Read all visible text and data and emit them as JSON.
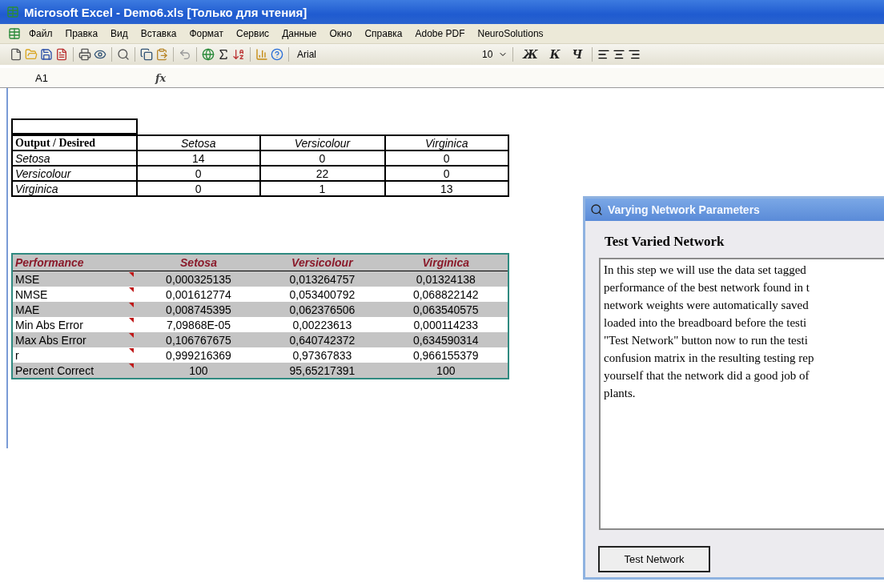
{
  "window": {
    "title": "Microsoft Excel - Demo6.xls  [Только для чтения]"
  },
  "menu": [
    "Файл",
    "Правка",
    "Вид",
    "Вставка",
    "Формат",
    "Сервис",
    "Данные",
    "Окно",
    "Справка",
    "Adobe PDF",
    "NeuroSolutions"
  ],
  "toolbar": {
    "font": "Arial",
    "size": "10",
    "format_buttons": [
      "Ж",
      "К",
      "Ч"
    ]
  },
  "formula_bar": {
    "name_box": "A1",
    "fx": "fx"
  },
  "confusion_table": {
    "columns": [
      "Output / Desired",
      "Setosa",
      "Versicolour",
      "Virginica"
    ],
    "rows": [
      [
        "Setosa",
        "14",
        "0",
        "0"
      ],
      [
        "Versicolour",
        "0",
        "22",
        "0"
      ],
      [
        "Virginica",
        "0",
        "1",
        "13"
      ]
    ]
  },
  "performance_table": {
    "columns": [
      "Performance",
      "Setosa",
      "Versicolour",
      "Virginica"
    ],
    "rows": [
      {
        "cells": [
          "MSE",
          "0,000325135",
          "0,013264757",
          "0,01324138"
        ],
        "comment": true
      },
      {
        "cells": [
          "NMSE",
          "0,001612774",
          "0,053400792",
          "0,068822142"
        ],
        "comment": true
      },
      {
        "cells": [
          "MAE",
          "0,008745395",
          "0,062376506",
          "0,063540575"
        ],
        "comment": true
      },
      {
        "cells": [
          "Min Abs Error",
          "7,09868E-05",
          "0,00223613",
          "0,000114233"
        ],
        "comment": true
      },
      {
        "cells": [
          "Max Abs Error",
          "0,106767675",
          "0,640742372",
          "0,634590314"
        ],
        "comment": true
      },
      {
        "cells": [
          "r",
          "0,999216369",
          "0,97367833",
          "0,966155379"
        ],
        "comment": true
      },
      {
        "cells": [
          "Percent Correct",
          "100",
          "95,65217391",
          "100"
        ],
        "comment": true
      }
    ]
  },
  "dialog": {
    "title": "Varying Network Parameters",
    "heading": "Test Varied Network",
    "body_lines": [
      "In this step we will use the data set tagged",
      "performance of the best network found in t",
      "network weights were automatically saved",
      "loaded into the breadboard before the testi",
      "\"Test Network\" button now to run the testi",
      "confusion matrix in the resulting testing rep",
      "yourself that the network did a good job of",
      "plants."
    ],
    "button": "Test Network"
  }
}
